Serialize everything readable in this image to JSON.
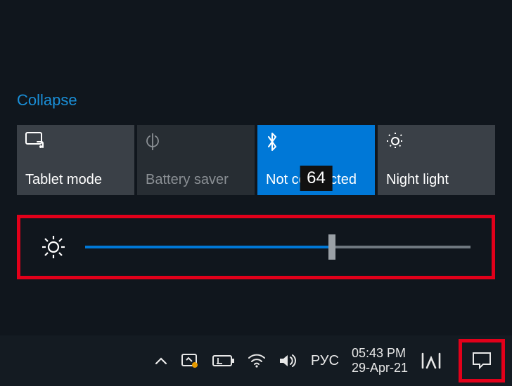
{
  "actionCenter": {
    "collapseLabel": "Collapse",
    "tiles": [
      {
        "label": "Tablet mode"
      },
      {
        "label": "Battery saver"
      },
      {
        "label": "Not connected",
        "value": "64"
      },
      {
        "label": "Night light"
      }
    ],
    "brightness": {
      "value": 64
    }
  },
  "taskbar": {
    "language": "РУС",
    "time": "05:43 PM",
    "date": "29-Apr-21"
  }
}
